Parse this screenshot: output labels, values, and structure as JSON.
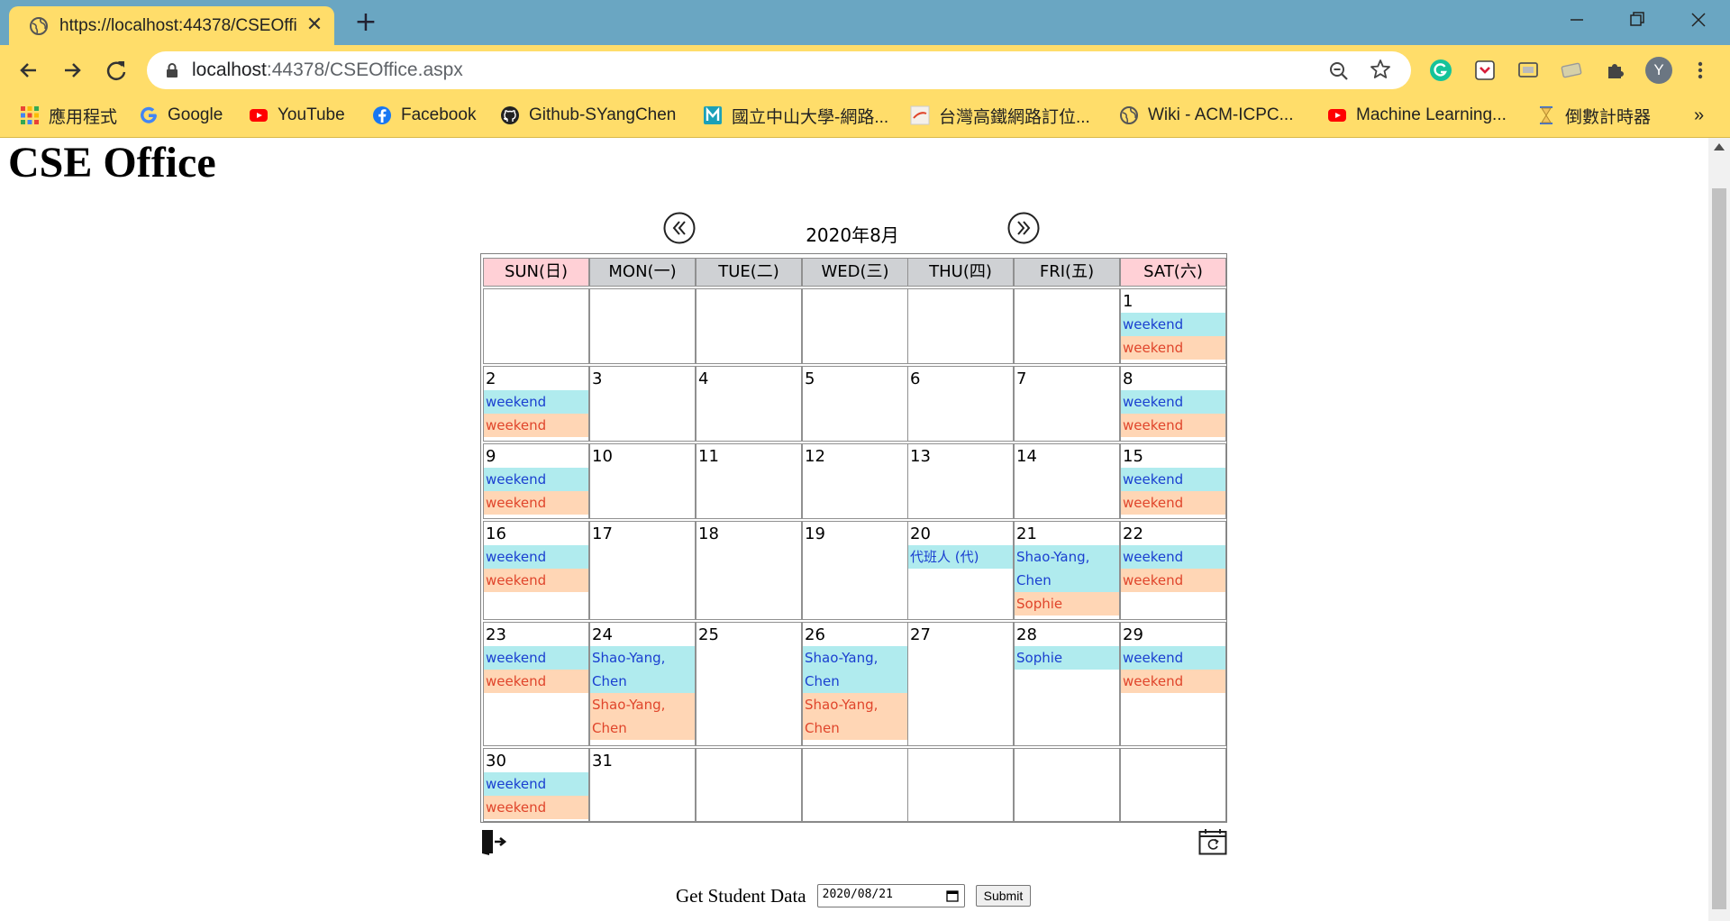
{
  "browser": {
    "tab_title": "https://localhost:44378/CSEOffi",
    "url_host": "localhost",
    "url_rest": ":44378/CSEOffice.aspx",
    "bookmarks": [
      {
        "label": "應用程式",
        "icon": "apps-grid-icon"
      },
      {
        "label": "Google",
        "icon": "google-icon"
      },
      {
        "label": "YouTube",
        "icon": "youtube-icon"
      },
      {
        "label": "Facebook",
        "icon": "facebook-icon"
      },
      {
        "label": "Github-SYangChen",
        "icon": "github-icon"
      },
      {
        "label": "國立中山大學-網路...",
        "icon": "nsysu-icon"
      },
      {
        "label": "台灣高鐵網路訂位...",
        "icon": "thsr-icon"
      },
      {
        "label": "Wiki - ACM-ICPC...",
        "icon": "globe-icon"
      },
      {
        "label": "Machine Learning...",
        "icon": "youtube-icon"
      },
      {
        "label": "倒數計時器",
        "icon": "hourglass-icon"
      }
    ],
    "more_bookmarks": "»",
    "profile_initial": "Y"
  },
  "page": {
    "title": "CSE Office",
    "month_label": "2020年8月",
    "weekday_headers": [
      "SUN(日)",
      "MON(一)",
      "TUE(二)",
      "WED(三)",
      "THU(四)",
      "FRI(五)",
      "SAT(六)"
    ],
    "weeks": [
      [
        null,
        null,
        null,
        null,
        null,
        null,
        {
          "day": "1",
          "events": [
            {
              "text": "weekend",
              "kind": "blue"
            },
            {
              "text": "weekend",
              "kind": "orange"
            }
          ]
        }
      ],
      [
        {
          "day": "2",
          "events": [
            {
              "text": "weekend",
              "kind": "blue"
            },
            {
              "text": "weekend",
              "kind": "orange"
            }
          ]
        },
        {
          "day": "3",
          "events": []
        },
        {
          "day": "4",
          "events": []
        },
        {
          "day": "5",
          "events": []
        },
        {
          "day": "6",
          "events": []
        },
        {
          "day": "7",
          "events": []
        },
        {
          "day": "8",
          "events": [
            {
              "text": "weekend",
              "kind": "blue"
            },
            {
              "text": "weekend",
              "kind": "orange"
            }
          ]
        }
      ],
      [
        {
          "day": "9",
          "events": [
            {
              "text": "weekend",
              "kind": "blue"
            },
            {
              "text": "weekend",
              "kind": "orange"
            }
          ]
        },
        {
          "day": "10",
          "events": []
        },
        {
          "day": "11",
          "events": []
        },
        {
          "day": "12",
          "events": []
        },
        {
          "day": "13",
          "events": []
        },
        {
          "day": "14",
          "events": []
        },
        {
          "day": "15",
          "events": [
            {
              "text": "weekend",
              "kind": "blue"
            },
            {
              "text": "weekend",
              "kind": "orange"
            }
          ]
        }
      ],
      [
        {
          "day": "16",
          "events": [
            {
              "text": "weekend",
              "kind": "blue"
            },
            {
              "text": "weekend",
              "kind": "orange"
            }
          ]
        },
        {
          "day": "17",
          "events": []
        },
        {
          "day": "18",
          "events": []
        },
        {
          "day": "19",
          "events": []
        },
        {
          "day": "20",
          "events": [
            {
              "text": "代班人 (代)",
              "kind": "blue"
            }
          ]
        },
        {
          "day": "21",
          "events": [
            {
              "text": "Shao-Yang,",
              "kind": "blue"
            },
            {
              "text": "Chen",
              "kind": "blue"
            },
            {
              "text": "Sophie",
              "kind": "orange"
            }
          ]
        },
        {
          "day": "22",
          "events": [
            {
              "text": "weekend",
              "kind": "blue"
            },
            {
              "text": "weekend",
              "kind": "orange"
            }
          ]
        }
      ],
      [
        {
          "day": "23",
          "events": [
            {
              "text": "weekend",
              "kind": "blue"
            },
            {
              "text": "weekend",
              "kind": "orange"
            }
          ]
        },
        {
          "day": "24",
          "events": [
            {
              "text": "Shao-Yang,",
              "kind": "blue"
            },
            {
              "text": "Chen",
              "kind": "blue"
            },
            {
              "text": "Shao-Yang,",
              "kind": "orange"
            },
            {
              "text": "Chen",
              "kind": "orange"
            }
          ]
        },
        {
          "day": "25",
          "events": []
        },
        {
          "day": "26",
          "events": [
            {
              "text": "Shao-Yang,",
              "kind": "blue"
            },
            {
              "text": "Chen",
              "kind": "blue"
            },
            {
              "text": "Shao-Yang,",
              "kind": "orange"
            },
            {
              "text": "Chen",
              "kind": "orange"
            }
          ]
        },
        {
          "day": "27",
          "events": []
        },
        {
          "day": "28",
          "events": [
            {
              "text": "Sophie",
              "kind": "blue"
            }
          ]
        },
        {
          "day": "29",
          "events": [
            {
              "text": "weekend",
              "kind": "blue"
            },
            {
              "text": "weekend",
              "kind": "orange"
            }
          ]
        }
      ],
      [
        {
          "day": "30",
          "events": [
            {
              "text": "weekend",
              "kind": "blue"
            },
            {
              "text": "weekend",
              "kind": "orange"
            }
          ]
        },
        {
          "day": "31",
          "events": []
        },
        null,
        null,
        null,
        null,
        null
      ]
    ],
    "student_form": {
      "label": "Get Student Data",
      "date_value": "2020/08/21",
      "submit_label": "Submit"
    }
  },
  "colors": {
    "tabstrip": "#6aa6c2",
    "toolbar": "#ffdd6a",
    "weekend_header": "#ffd0d6",
    "weekday_header": "#cfd1d4",
    "event_blue_bg": "#b0ebee",
    "event_blue_text": "#1a3fd0",
    "event_orange_bg": "#ffd6b5",
    "event_orange_text": "#e0452b"
  }
}
